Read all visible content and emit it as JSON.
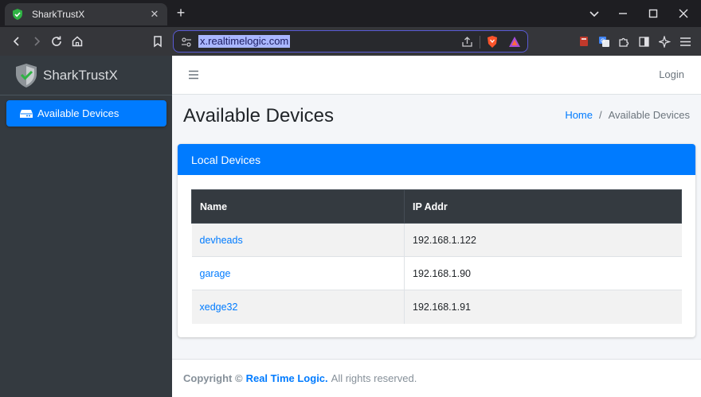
{
  "browser": {
    "tab_title": "SharkTrustX",
    "tab_close": "✕",
    "new_tab": "+",
    "url": "x.realtimelogic.com"
  },
  "sidebar": {
    "brand": "SharkTrustX",
    "items": [
      {
        "label": "Available Devices",
        "icon": "hdd-icon",
        "active": true
      }
    ]
  },
  "topnav": {
    "login": "Login"
  },
  "page": {
    "title": "Available Devices",
    "breadcrumb": {
      "home": "Home",
      "separator": "/",
      "current": "Available Devices"
    }
  },
  "card": {
    "title": "Local Devices",
    "columns": [
      "Name",
      "IP Addr"
    ],
    "rows": [
      {
        "name": "devheads",
        "ip": "192.168.1.122"
      },
      {
        "name": "garage",
        "ip": "192.168.1.90"
      },
      {
        "name": "xedge32",
        "ip": "192.168.1.91"
      }
    ]
  },
  "footer": {
    "prefix": "Copyright ©",
    "company": "Real Time Logic.",
    "suffix": "All rights reserved."
  },
  "colors": {
    "primary": "#007bff",
    "sidebar_bg": "#343a40",
    "content_bg": "#f4f6f9"
  }
}
